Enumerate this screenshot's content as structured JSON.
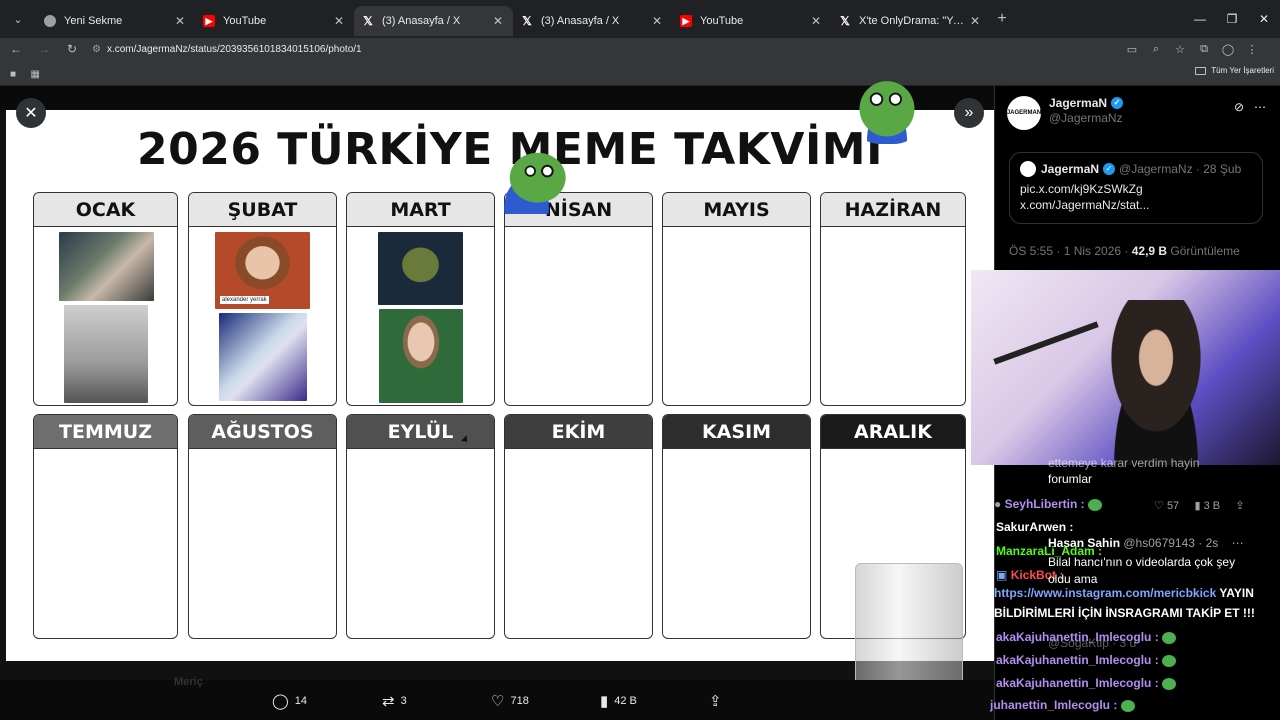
{
  "browser": {
    "tabs": [
      {
        "title": "Yeni Sekme",
        "icon": "chrome-icon"
      },
      {
        "title": "YouTube",
        "icon": "youtube-icon"
      },
      {
        "title": "(3) Anasayfa / X",
        "icon": "x-icon",
        "active": true
      },
      {
        "title": "(3) Anasayfa / X",
        "icon": "x-icon"
      },
      {
        "title": "YouTube",
        "icon": "youtube-icon"
      },
      {
        "title": "X'te OnlyDrama: \"YakupTV, ken",
        "icon": "x-icon"
      }
    ],
    "url": "x.com/JagermaNz/status/2039356101834015106/photo/1",
    "bookmarks_folder": "Tüm Yer İşaretleri"
  },
  "calendar": {
    "title": "2026 TÜRKİYE MEME TAKVİMİ",
    "months_row1": [
      "OCAK",
      "ŞUBAT",
      "MART",
      "NİSAN",
      "MAYIS",
      "HAZİRAN"
    ],
    "months_row2": [
      "TEMMUZ",
      "AĞUSTOS",
      "EYLÜL",
      "EKİM",
      "KASIM",
      "ARALIK"
    ],
    "subat_caption": "alexander yerrak"
  },
  "post_actions": {
    "replies": "14",
    "reposts": "3",
    "likes": "718",
    "views": "42 B"
  },
  "sidebar": {
    "author_name": "JagermaN",
    "author_handle": "@JagermaNz",
    "avatar_text": "JAGERMAN",
    "quote": {
      "name": "JagermaN",
      "meta": "@JagermaNz · 28 Şub",
      "line1": "pic.x.com/kj9KzSWkZg",
      "line2": "x.com/JagermaNz/stat..."
    },
    "timestamp": "ÖS 5:55 · 1 Nis 2026 · ",
    "views_count": "42,9 B",
    "views_label": " Görüntüleme"
  },
  "chat": {
    "line_forum_a": "ettemeye karar verdim hayin",
    "line_forum_b": "forumlar",
    "user1": "SeyhLibertin :",
    "stats_likes": "57",
    "stats_views": "3 B",
    "user2": "SakurArwen :",
    "reply_name": "Hasan Sahin",
    "reply_handle": "@hs0679143 · 2s",
    "user3": "ManzaraLi_Adam :",
    "reply_text_a": "Bilal hancı'nın o videolarda çok şey",
    "user4": "KickBot :",
    "reply_text_b": "oldu ama",
    "announce_link": "https://www.instagram.com/mericbkick",
    "announce_a": " YAYIN",
    "announce_b": "BİLDİRİMLERİ İÇİN İNSRAGRAMI TAKİP ET !!!",
    "user5": "akaKajuhanettin_Imlecoglu :",
    "user6": "akaKajuhanettin_Imlecoglu :",
    "user7": "akaKajuhanettin_Imlecoglu :",
    "user8": "juhanettin_Imlecoglu :",
    "reply_handle2": "@SogaKtip · 3 u",
    "bg_name": "Meriç"
  }
}
